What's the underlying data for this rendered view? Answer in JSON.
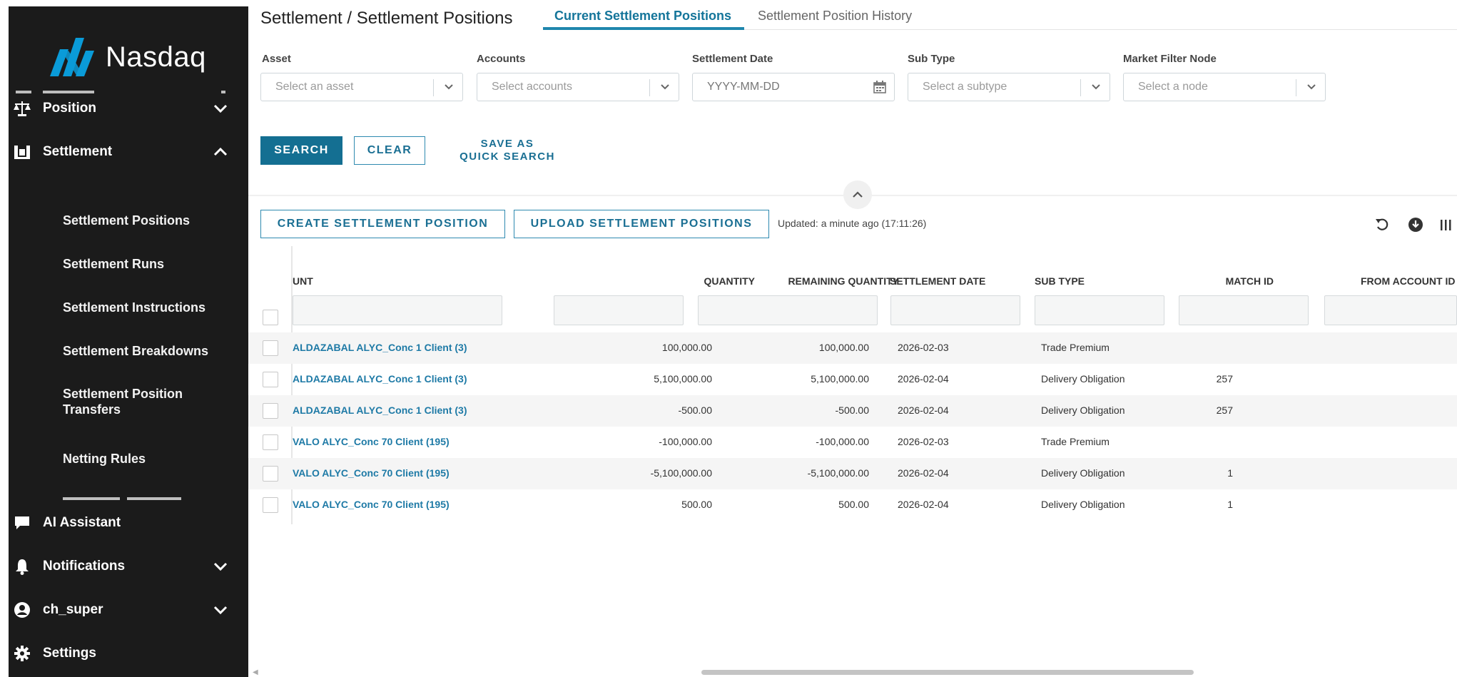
{
  "brand": {
    "name": "Nasdaq",
    "color": "#0a9bd8"
  },
  "sidebar": {
    "items": [
      {
        "icon": "balance-scale-icon",
        "label": "Position",
        "expanded": false
      },
      {
        "icon": "settlement-icon",
        "label": "Settlement",
        "expanded": true
      }
    ],
    "settlement_subitems": [
      "Settlement Positions",
      "Settlement Runs",
      "Settlement Instructions",
      "Settlement Breakdowns",
      "Settlement Position Transfers",
      "Netting Rules"
    ],
    "bottom_items": [
      {
        "icon": "chat-icon",
        "label": "AI Assistant"
      },
      {
        "icon": "bell-icon",
        "label": "Notifications",
        "expanded": false
      },
      {
        "icon": "user-circle-icon",
        "label": "ch_super",
        "expanded": false
      },
      {
        "icon": "gear-icon",
        "label": "Settings"
      }
    ]
  },
  "header": {
    "title": "Settlement / Settlement Positions",
    "tabs": [
      {
        "label": "Current Settlement Positions",
        "active": true
      },
      {
        "label": "Settlement Position History",
        "active": false
      }
    ]
  },
  "filters": [
    {
      "label": "Asset",
      "placeholder": "Select an asset",
      "kind": "select"
    },
    {
      "label": "Accounts",
      "placeholder": "Select accounts",
      "kind": "select"
    },
    {
      "label": "Settlement Date",
      "placeholder": "YYYY-MM-DD",
      "kind": "date"
    },
    {
      "label": "Sub Type",
      "placeholder": "Select a subtype",
      "kind": "select"
    },
    {
      "label": "Market Filter Node",
      "placeholder": "Select a node",
      "kind": "select"
    }
  ],
  "actions": {
    "search": "SEARCH",
    "clear": "CLEAR",
    "quick_search_line1": "SAVE AS",
    "quick_search_line2": "QUICK SEARCH",
    "create": "CREATE SETTLEMENT POSITION",
    "upload": "UPLOAD SETTLEMENT POSITIONS",
    "updated": "Updated: a minute ago (17:11:26)"
  },
  "table": {
    "columns": [
      "UNT",
      "QUANTITY",
      "REMAINING QUANTITY",
      "SETTLEMENT DATE",
      "SUB TYPE",
      "MATCH ID",
      "FROM ACCOUNT ID"
    ],
    "rows": [
      {
        "account": "ALDAZABAL ALYC_Conc 1 Client (3)",
        "quantity": "100,000.00",
        "remaining": "100,000.00",
        "date": "2026-02-03",
        "sub_type": "Trade Premium",
        "match_id": "",
        "from_account": ""
      },
      {
        "account": "ALDAZABAL ALYC_Conc 1 Client (3)",
        "quantity": "5,100,000.00",
        "remaining": "5,100,000.00",
        "date": "2026-02-04",
        "sub_type": "Delivery Obligation",
        "match_id": "257",
        "from_account": ""
      },
      {
        "account": "ALDAZABAL ALYC_Conc 1 Client (3)",
        "quantity": "-500.00",
        "remaining": "-500.00",
        "date": "2026-02-04",
        "sub_type": "Delivery Obligation",
        "match_id": "257",
        "from_account": ""
      },
      {
        "account": "VALO ALYC_Conc 70 Client (195)",
        "quantity": "-100,000.00",
        "remaining": "-100,000.00",
        "date": "2026-02-03",
        "sub_type": "Trade Premium",
        "match_id": "",
        "from_account": ""
      },
      {
        "account": "VALO ALYC_Conc 70 Client (195)",
        "quantity": "-5,100,000.00",
        "remaining": "-5,100,000.00",
        "date": "2026-02-04",
        "sub_type": "Delivery Obligation",
        "match_id": "1",
        "from_account": ""
      },
      {
        "account": "VALO ALYC_Conc 70 Client (195)",
        "quantity": "500.00",
        "remaining": "500.00",
        "date": "2026-02-04",
        "sub_type": "Delivery Obligation",
        "match_id": "1",
        "from_account": ""
      }
    ]
  },
  "colors": {
    "accent": "#146f92",
    "link": "#1e7aa6",
    "sidebar_bg": "#1b1b1b"
  }
}
